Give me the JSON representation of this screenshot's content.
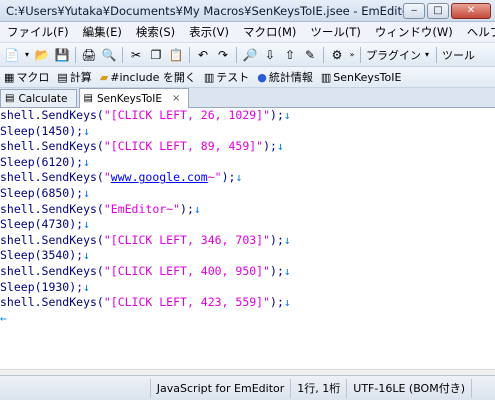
{
  "window": {
    "title": "C:¥Users¥Yutaka¥Documents¥My Macros¥SenKeysToIE.jsee - EmEditor",
    "min": "‒",
    "max": "□",
    "close": "✕"
  },
  "menu": {
    "items": [
      {
        "label": "ファイル(F)"
      },
      {
        "label": "編集(E)"
      },
      {
        "label": "検索(S)"
      },
      {
        "label": "表示(V)"
      },
      {
        "label": "マクロ(M)"
      },
      {
        "label": "ツール(T)"
      },
      {
        "label": "ウィンドウ(W)"
      },
      {
        "label": "ヘルプ(H)"
      }
    ]
  },
  "toolbar": {
    "plugin_label": "プラグイン",
    "tools_label": "ツール"
  },
  "macrobar": {
    "items": [
      {
        "label": "マクロ",
        "icon": "macro-icon"
      },
      {
        "label": "計算",
        "icon": "calculator-icon"
      },
      {
        "label": "#include を開く",
        "icon": "folder-icon"
      },
      {
        "label": "テスト",
        "icon": "script-icon"
      },
      {
        "label": "統計情報",
        "icon": "stats-icon"
      },
      {
        "label": "SenKeysToIE",
        "icon": "script-icon"
      }
    ]
  },
  "tabs": [
    {
      "label": "Calculate",
      "active": false
    },
    {
      "label": "SenKeysToIE",
      "active": true,
      "close": "×"
    }
  ],
  "editor": {
    "lines": [
      {
        "fn": "shell.SendKeys(",
        "str": "\"[CLICK LEFT, 26, 1029]\"",
        "tail": ");",
        "eol": "↓"
      },
      {
        "fn": "Sleep(1450);",
        "str": "",
        "tail": "",
        "eol": "↓"
      },
      {
        "fn": "shell.SendKeys(",
        "str": "\"[CLICK LEFT, 89, 459]\"",
        "tail": ");",
        "eol": "↓"
      },
      {
        "fn": "Sleep(6120);",
        "str": "",
        "tail": "",
        "eol": "↓"
      },
      {
        "fn": "shell.SendKeys(",
        "str": "\"",
        "url": "www.google.com",
        "str2": "~\"",
        "tail": ");",
        "eol": "↓"
      },
      {
        "fn": "Sleep(6850);",
        "str": "",
        "tail": "",
        "eol": "↓"
      },
      {
        "fn": "shell.SendKeys(",
        "str": "\"EmEditor~\"",
        "tail": ");",
        "eol": "↓"
      },
      {
        "fn": "Sleep(4730);",
        "str": "",
        "tail": "",
        "eol": "↓"
      },
      {
        "fn": "shell.SendKeys(",
        "str": "\"[CLICK LEFT, 346, 703]\"",
        "tail": ");",
        "eol": "↓"
      },
      {
        "fn": "Sleep(3540);",
        "str": "",
        "tail": "",
        "eol": "↓"
      },
      {
        "fn": "shell.SendKeys(",
        "str": "\"[CLICK LEFT, 400, 950]\"",
        "tail": ");",
        "eol": "↓"
      },
      {
        "fn": "Sleep(1930);",
        "str": "",
        "tail": "",
        "eol": "↓"
      },
      {
        "fn": "shell.SendKeys(",
        "str": "\"[CLICK LEFT, 423, 559]\"",
        "tail": ");",
        "eol": "↓"
      },
      {
        "fn": "",
        "str": "",
        "tail": "",
        "eol": "←"
      }
    ]
  },
  "status": {
    "syntax": "JavaScript for EmEditor",
    "position": "1行, 1桁",
    "encoding": "UTF-16LE (BOM付き)"
  },
  "colors": {
    "string": "#e000e0",
    "eol_mark": "#0080ff",
    "url": "#0000ff"
  }
}
